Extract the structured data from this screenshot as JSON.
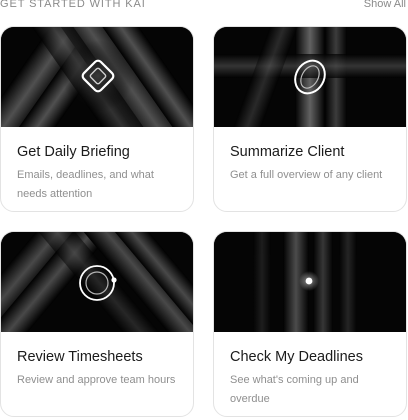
{
  "header": {
    "section_title": "GET STARTED WITH KAI",
    "show_all_label": "Show All"
  },
  "cards": [
    {
      "title": "Get Daily Briefing",
      "description": "Emails, deadlines, and what needs attention",
      "icon": "diamond-icon"
    },
    {
      "title": "Summarize Client",
      "description": "Get a full overview of any client",
      "icon": "leaf-ring-icon"
    },
    {
      "title": "Review Timesheets",
      "description": "Review and approve team hours",
      "icon": "orbit-ring-icon"
    },
    {
      "title": "Check My Deadlines",
      "description": "See what's coming up and overdue",
      "icon": "dot-icon"
    }
  ],
  "colors": {
    "art_background": "#050505",
    "title_text": "#1b1b1b",
    "muted_text": "#8a8a8a",
    "card_border": "#e3e3e3"
  }
}
